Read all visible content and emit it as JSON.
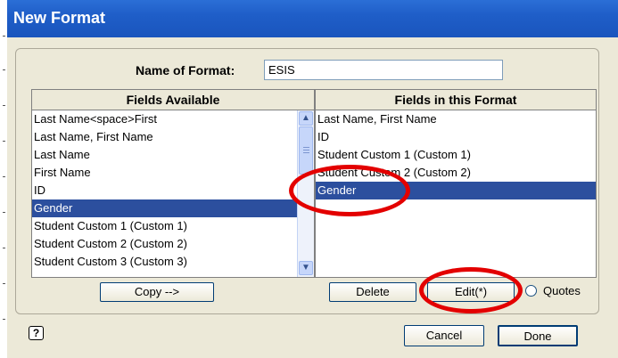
{
  "window": {
    "title": "New Format"
  },
  "name_field": {
    "label": "Name of Format:",
    "value": "ESIS"
  },
  "available": {
    "header": "Fields Available",
    "items": [
      "Last Name<space>First",
      "Last Name, First Name",
      "Last Name",
      "First Name",
      "ID",
      "Gender",
      "Student Custom 1 (Custom 1)",
      "Student Custom 2 (Custom 2)",
      "Student Custom 3 (Custom 3)"
    ],
    "selected": "Gender"
  },
  "in_format": {
    "header": "Fields in this Format",
    "items": [
      "Last Name, First Name",
      "ID",
      "Student Custom 1 (Custom 1)",
      "Student Custom 2 (Custom 2)",
      "Gender"
    ],
    "selected": "Gender"
  },
  "buttons": {
    "copy": "Copy -->",
    "delete": "Delete",
    "edit": "Edit(*)",
    "quotes": "Quotes",
    "cancel": "Cancel",
    "done": "Done"
  },
  "icons": {
    "help": "?"
  },
  "colors": {
    "selection": "#2c4f9e",
    "title_bar": "#1f5ec8",
    "annotation": "#e30000"
  }
}
